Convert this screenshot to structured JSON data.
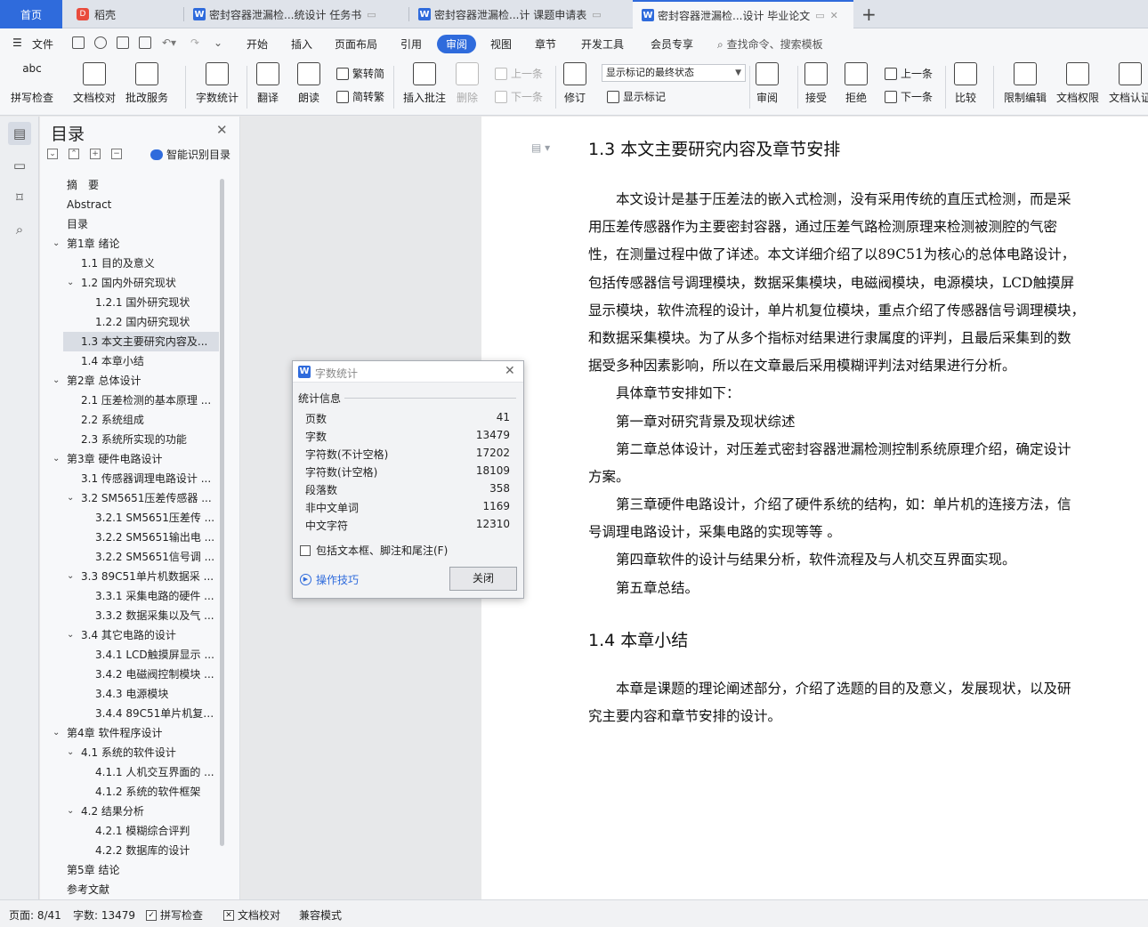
{
  "tabs": {
    "home": "首页",
    "daoke": "稻壳",
    "doc1": "密封容器泄漏检...统设计 任务书",
    "doc2": "密封容器泄漏检...计 课题申请表",
    "doc3": "密封容器泄漏检...设计 毕业论文",
    "new_tab": "+"
  },
  "menu": {
    "file": "文件",
    "items": [
      "开始",
      "插入",
      "页面布局",
      "引用",
      "审阅",
      "视图",
      "章节",
      "开发工具",
      "会员专享"
    ],
    "active": "审阅",
    "search": "查找命令、搜索模板"
  },
  "ribbon": {
    "spellcheck": "拼写检查",
    "doc_check": "文档校对",
    "batch_service": "批改服务",
    "word_count": "字数统计",
    "translate": "翻译",
    "read_aloud": "朗读",
    "to_simplified": "繁转简",
    "to_traditional": "简转繁",
    "insert_comment": "插入批注",
    "delete": "删除",
    "prev_comment": "上一条",
    "next_comment": "下一条",
    "revise": "修订",
    "markup_state": "显示标记的最终状态",
    "show_markup": "显示标记",
    "review": "审阅",
    "accept": "接受",
    "reject": "拒绝",
    "prev_change": "上一条",
    "next_change": "下一条",
    "compare": "比较",
    "restrict_edit": "限制编辑",
    "doc_permission": "文档权限",
    "doc_auth": "文档认证"
  },
  "toc": {
    "title": "目录",
    "smart": "智能识别目录",
    "items": [
      {
        "text": "摘　要",
        "level": 1
      },
      {
        "text": "Abstract",
        "level": 1
      },
      {
        "text": "目录",
        "level": 1
      },
      {
        "text": "第1章  绪论",
        "level": 1,
        "caret": true
      },
      {
        "text": "1.1  目的及意义",
        "level": 2
      },
      {
        "text": "1.2  国内外研究现状",
        "level": 2,
        "caret": true
      },
      {
        "text": "1.2.1  国外研究现状",
        "level": 3
      },
      {
        "text": "1.2.2  国内研究现状",
        "level": 3
      },
      {
        "text": "1.3  本文主要研究内容及...",
        "level": 2,
        "selected": true
      },
      {
        "text": "1.4  本章小结",
        "level": 2
      },
      {
        "text": "第2章  总体设计",
        "level": 1,
        "caret": true
      },
      {
        "text": "2.1  压差检测的基本原理 ...",
        "level": 2
      },
      {
        "text": "2.2  系统组成",
        "level": 2
      },
      {
        "text": "2.3  系统所实现的功能",
        "level": 2
      },
      {
        "text": "第3章  硬件电路设计",
        "level": 1,
        "caret": true
      },
      {
        "text": "3.1  传感器调理电路设计 ...",
        "level": 2
      },
      {
        "text": "3.2 SM5651压差传感器 ...",
        "level": 2,
        "caret": true
      },
      {
        "text": "3.2.1 SM5651压差传 ...",
        "level": 3
      },
      {
        "text": "3.2.2 SM5651输出电 ...",
        "level": 3
      },
      {
        "text": "3.2.2 SM5651信号调 ...",
        "level": 3
      },
      {
        "text": "3.3 89C51单片机数据采 ...",
        "level": 2,
        "caret": true
      },
      {
        "text": "3.3.1  采集电路的硬件 ...",
        "level": 3
      },
      {
        "text": "3.3.2  数据采集以及气 ...",
        "level": 3
      },
      {
        "text": "3.4  其它电路的设计",
        "level": 2,
        "caret": true
      },
      {
        "text": "3.4.1 LCD触摸屏显示 ...",
        "level": 3
      },
      {
        "text": "3.4.2  电磁阀控制模块 ...",
        "level": 3
      },
      {
        "text": "3.4.3  电源模块",
        "level": 3
      },
      {
        "text": "3.4.4 89C51单片机复 ...",
        "level": 3
      },
      {
        "text": "第4章  软件程序设计",
        "level": 1,
        "caret": true
      },
      {
        "text": "4.1  系统的软件设计",
        "level": 2,
        "caret": true
      },
      {
        "text": "4.1.1  人机交互界面的 ...",
        "level": 3
      },
      {
        "text": "4.1.2  系统的软件框架",
        "level": 3
      },
      {
        "text": "4.2  结果分析",
        "level": 2,
        "caret": true
      },
      {
        "text": "4.2.1  模糊综合评判",
        "level": 3
      },
      {
        "text": "4.2.2  数据库的设计",
        "level": 3
      },
      {
        "text": "第5章  结论",
        "level": 1
      },
      {
        "text": "参考文献",
        "level": 1
      }
    ]
  },
  "document": {
    "heading1": "1.3  本文主要研究内容及章节安排",
    "para1_lines": [
      "　　本文设计是基于压差法的嵌入式检测，没有采用传统的直压式检测，而是采",
      "用压差传感器作为主要密封容器，通过压差气路检测原理来检测被测腔的气密",
      "性，在测量过程中做了详述。本文详细介绍了以89C51为核心的总体电路设计，",
      "包括传感器信号调理模块，数据采集模块，电磁阀模块，电源模块，LCD触摸屏",
      "显示模块，软件流程的设计，单片机复位模块，重点介绍了传感器信号调理模块，",
      "和数据采集模块。为了从多个指标对结果进行隶属度的评判，且最后采集到的数",
      "据受多种因素影响，所以在文章最后采用模糊评判法对结果进行分析。",
      "　　具体章节安排如下：",
      "　　第一章对研究背景及现状综述",
      "　　第二章总体设计，对压差式密封容器泄漏检测控制系统原理介绍，确定设计",
      "方案。",
      "　　第三章硬件电路设计，介绍了硬件系统的结构，如：单片机的连接方法，信",
      "号调理电路设计，采集电路的实现等等  。",
      "　　第四章软件的设计与结果分析，软件流程及与人机交互界面实现。",
      "　　第五章总结。"
    ],
    "heading2": "1.4  本章小结",
    "para2_lines": [
      "　　本章是课题的理论阐述部分，介绍了选题的目的及意义，发展现状，以及研",
      "究主要内容和章节安排的设计。"
    ]
  },
  "dialog": {
    "title": "字数统计",
    "section": "统计信息",
    "stats": [
      {
        "label": "页数",
        "value": "41"
      },
      {
        "label": "字数",
        "value": "13479"
      },
      {
        "label": "字符数(不计空格)",
        "value": "17202"
      },
      {
        "label": "字符数(计空格)",
        "value": "18109"
      },
      {
        "label": "段落数",
        "value": "358"
      },
      {
        "label": "非中文单词",
        "value": "1169"
      },
      {
        "label": "中文字符",
        "value": "12310"
      }
    ],
    "checkbox": "包括文本框、脚注和尾注(F)",
    "tips": "操作技巧",
    "close_button": "关闭"
  },
  "status": {
    "page": "页面: 8/41",
    "words": "字数: 13479",
    "spell": "拼写检查",
    "doccheck": "文档校对",
    "compat": "兼容模式"
  },
  "colors": {
    "accent": "#2f6bdc"
  }
}
